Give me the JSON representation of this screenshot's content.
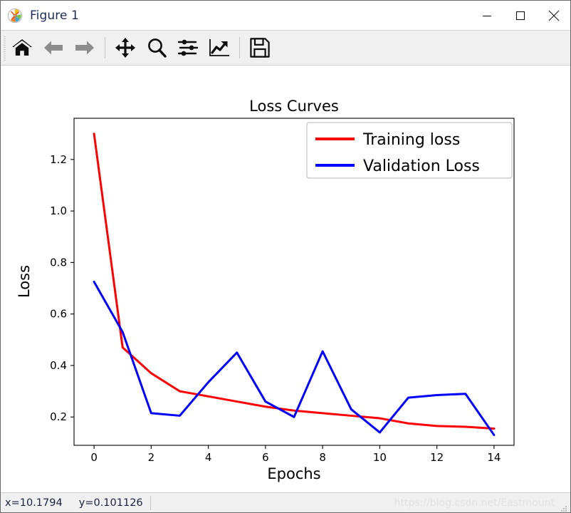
{
  "window": {
    "title": "Figure 1",
    "app_icon": "matplotlib-logo-icon",
    "minimize_label": "—",
    "maximize_label": "□",
    "close_label": "×"
  },
  "toolbar": {
    "buttons": [
      {
        "name": "home-icon",
        "tooltip": "Reset original view",
        "enabled": true
      },
      {
        "name": "back-arrow-icon",
        "tooltip": "Back to previous view",
        "enabled": false
      },
      {
        "name": "forward-arrow-icon",
        "tooltip": "Forward to next view",
        "enabled": false
      },
      {
        "name": "pan-move-icon",
        "tooltip": "Pan axes with left mouse, zoom with right",
        "enabled": true
      },
      {
        "name": "zoom-magnifier-icon",
        "tooltip": "Zoom to rectangle",
        "enabled": true
      },
      {
        "name": "configure-subplots-icon",
        "tooltip": "Configure subplots",
        "enabled": true
      },
      {
        "name": "edit-axis-curve-icon",
        "tooltip": "Edit axis, curve and image parameters",
        "enabled": true
      },
      {
        "name": "save-floppy-icon",
        "tooltip": "Save the figure",
        "enabled": true
      }
    ]
  },
  "statusbar": {
    "x_readout": "x=10.1794",
    "y_readout": "y=0.101126",
    "watermark": "https://blog.csdn.net/Eastmount"
  },
  "chart_data": {
    "type": "line",
    "title": "Loss Curves",
    "xlabel": "Epochs",
    "ylabel": "Loss",
    "grid": false,
    "legend_position": "upper right",
    "xlim": [
      -0.7,
      14.7
    ],
    "ylim": [
      0.09,
      1.36
    ],
    "xticks": [
      0,
      2,
      4,
      6,
      8,
      10,
      12,
      14
    ],
    "xticklabels": [
      "0",
      "2",
      "4",
      "6",
      "8",
      "10",
      "12",
      "14"
    ],
    "yticks": [
      0.2,
      0.4,
      0.6,
      0.8,
      1.0,
      1.2
    ],
    "yticklabels": [
      "0.2",
      "0.4",
      "0.6",
      "0.8",
      "1.0",
      "1.2"
    ],
    "x": [
      0,
      1,
      2,
      3,
      4,
      5,
      6,
      7,
      8,
      9,
      10,
      11,
      12,
      13,
      14
    ],
    "series": [
      {
        "name": "Training loss",
        "color": "#ff0000",
        "linewidth": 3,
        "values": [
          1.3,
          0.47,
          0.37,
          0.3,
          0.28,
          0.26,
          0.24,
          0.225,
          0.215,
          0.205,
          0.195,
          0.175,
          0.165,
          0.162,
          0.155
        ]
      },
      {
        "name": "Validation Loss",
        "color": "#0000ff",
        "linewidth": 3,
        "values": [
          0.725,
          0.53,
          0.215,
          0.205,
          0.335,
          0.45,
          0.26,
          0.2,
          0.455,
          0.23,
          0.14,
          0.275,
          0.285,
          0.29,
          0.13
        ]
      }
    ]
  },
  "legend": {
    "entries": [
      {
        "label": "Training loss",
        "color": "#ff0000"
      },
      {
        "label": "Validation Loss",
        "color": "#0000ff"
      }
    ]
  }
}
